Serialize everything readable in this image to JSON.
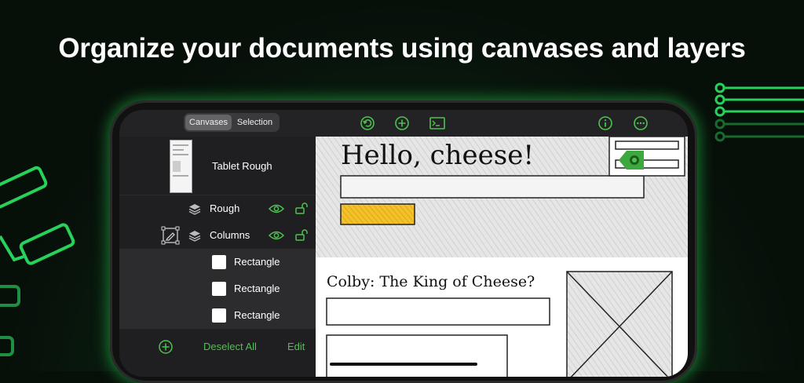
{
  "headline": "Organize your documents using canvases and layers",
  "toolbar": {
    "segments": [
      "Canvases",
      "Selection"
    ],
    "icons": [
      "undo-icon",
      "add-icon",
      "terminal-icon",
      "info-icon",
      "more-icon"
    ]
  },
  "sidebar": {
    "document_title": "Tablet Rough",
    "layers": [
      {
        "label": "Rough"
      },
      {
        "label": "Columns"
      }
    ],
    "items": [
      {
        "label": "Rectangle"
      },
      {
        "label": "Rectangle"
      },
      {
        "label": "Rectangle"
      }
    ],
    "bottom": {
      "deselect_label": "Deselect All",
      "edit_label": "Edit"
    }
  },
  "canvas": {
    "heading": "Hello, cheese!",
    "subheading": "Colby: The King of Cheese?"
  },
  "colors": {
    "accent": "#4ec24e",
    "highlight": "#f3c12a",
    "glow": "#2bd65a"
  }
}
